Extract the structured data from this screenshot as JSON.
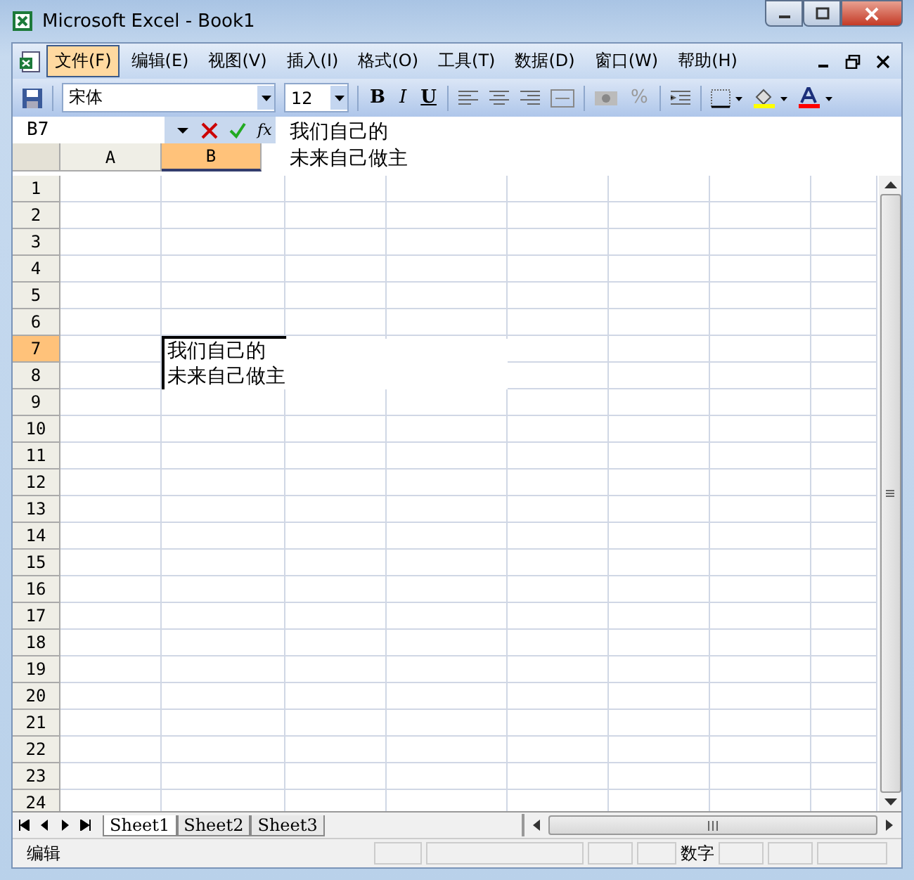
{
  "window": {
    "title": "Microsoft Excel - Book1"
  },
  "menu": [
    {
      "label": "文件(F)",
      "selected": true
    },
    {
      "label": "编辑(E)",
      "selected": false
    },
    {
      "label": "视图(V)",
      "selected": false
    },
    {
      "label": "插入(I)",
      "selected": false
    },
    {
      "label": "格式(O)",
      "selected": false
    },
    {
      "label": "工具(T)",
      "selected": false
    },
    {
      "label": "数据(D)",
      "selected": false
    },
    {
      "label": "窗口(W)",
      "selected": false
    },
    {
      "label": "帮助(H)",
      "selected": false
    }
  ],
  "toolbar": {
    "font": "宋体",
    "size": "12",
    "bold": "B",
    "italic": "I",
    "underline": "U",
    "percent": "%"
  },
  "formula_bar": {
    "name_box": "B7",
    "fx": "fx",
    "lines": [
      "我们自己的",
      "未来自己做主"
    ]
  },
  "columns": [
    {
      "label": "A",
      "selected": false
    },
    {
      "label": "B",
      "selected": true
    }
  ],
  "rows": [
    {
      "label": "1",
      "selected": false
    },
    {
      "label": "2",
      "selected": false
    },
    {
      "label": "3",
      "selected": false
    },
    {
      "label": "4",
      "selected": false
    },
    {
      "label": "5",
      "selected": false
    },
    {
      "label": "6",
      "selected": false
    },
    {
      "label": "7",
      "selected": true
    },
    {
      "label": "8",
      "selected": false
    },
    {
      "label": "9",
      "selected": false
    },
    {
      "label": "10",
      "selected": false
    },
    {
      "label": "11",
      "selected": false
    },
    {
      "label": "12",
      "selected": false
    },
    {
      "label": "13",
      "selected": false
    },
    {
      "label": "14",
      "selected": false
    },
    {
      "label": "15",
      "selected": false
    },
    {
      "label": "16",
      "selected": false
    },
    {
      "label": "17",
      "selected": false
    },
    {
      "label": "18",
      "selected": false
    },
    {
      "label": "19",
      "selected": false
    },
    {
      "label": "20",
      "selected": false
    },
    {
      "label": "21",
      "selected": false
    },
    {
      "label": "22",
      "selected": false
    },
    {
      "label": "23",
      "selected": false
    },
    {
      "label": "24",
      "selected": false
    }
  ],
  "cell_editor": {
    "lines": [
      "我们自己的",
      "未来自己做主"
    ]
  },
  "sheets": [
    {
      "label": "Sheet1",
      "selected": true
    },
    {
      "label": "Sheet2",
      "selected": false
    },
    {
      "label": "Sheet3",
      "selected": false
    }
  ],
  "status_bar": {
    "mode": "编辑",
    "num": "数字"
  }
}
